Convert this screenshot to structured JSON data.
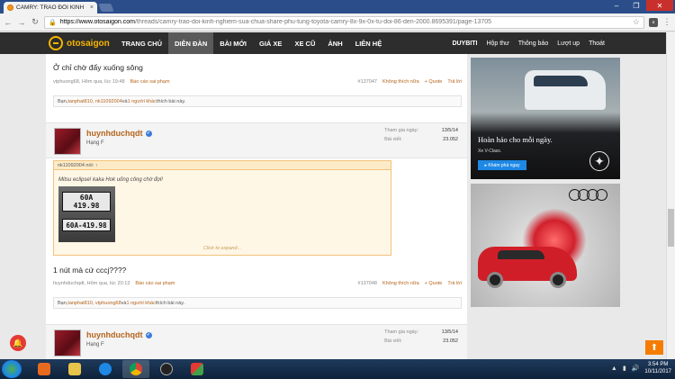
{
  "browser": {
    "tab_title": "CAMRY: TRAO ĐỔI KINH",
    "tab_close": "×",
    "url_host": "https://www.otosaigon.com",
    "url_path": "/threads/camry-trao-doi-kinh-nghiem-sua-chua-share-phu-tung-toyota-camry-8x-9x-0x-tu-doi-86-den-2000.8695391/page-13705",
    "ext_badge": "u"
  },
  "site": {
    "logo": "otosaigon",
    "menu": [
      "TRANG CHỦ",
      "DIỄN ĐÀN",
      "BÀI MỚI",
      "GIÁ XE",
      "XE CŨ",
      "ẢNH",
      "LIÊN HỆ"
    ],
    "user_menu": [
      "DUYBITI",
      "Hộp thư",
      "Thông báo",
      "Lượt up",
      "Thoát"
    ]
  },
  "post1": {
    "title": "Ở chỉ chờ đẩy xuống sông",
    "author": "vtphuong68",
    "time": "Hôm qua, lúc 19:48",
    "report": "Báo cáo sai phạm",
    "number": "#137047",
    "unlike": "Không thích nữa",
    "quote_btn": "+ Quote",
    "reply": "Trả lời",
    "likes": {
      "prefix": "Bạn, ",
      "users": "tanphat810, nk11092004",
      "middle": " và ",
      "others": "1 người khác",
      "suffix": " thích bài này."
    }
  },
  "user_block1": {
    "name": "huynhduchqdt",
    "rank": "Hạng F",
    "joined_label": "Tham gia ngày:",
    "joined_value": "13/5/14",
    "posts_label": "Bài viết:",
    "posts_value": "23.052"
  },
  "quote": {
    "header": "nk11092004 nói: ↑",
    "text": "Mitsu eclipse! kaka Hok uống công chờ đợi!",
    "plate_top": "60A",
    "plate_mid": "419.98",
    "plate_bottom": "60A-419.98",
    "expand": "Click to expand..."
  },
  "post2": {
    "title": "1 nút mà cứ cccj????",
    "author": "huynhduchqdt",
    "time": "Hôm qua, lúc 20:13",
    "report": "Báo cáo sai phạm",
    "number": "#137048",
    "unlike": "Không thích nữa",
    "quote_btn": "+ Quote",
    "reply": "Trả lời",
    "likes": {
      "prefix": "Bạn, ",
      "users": "tanphat810, vtphuong68",
      "middle": " và ",
      "others": "1 người khác",
      "suffix": " thích bài này."
    }
  },
  "user_block2": {
    "name": "huynhduchqdt",
    "rank": "Hạng F",
    "joined_label": "Tham gia ngày:",
    "joined_value": "13/5/14",
    "posts_label": "Bài viết:",
    "posts_value": "23.052"
  },
  "ads": {
    "mb_headline": "Hoàn hảo cho mỗi ngày.",
    "mb_sub": "Xe V-Class.",
    "mb_button": "▸ Khám phá ngay"
  },
  "taskbar": {
    "time": "3:54 PM",
    "date": "10/11/2017"
  },
  "colors": {
    "accent": "#b5651d",
    "nav_bg": "#2d2d2d",
    "logo": "#f7b500"
  }
}
